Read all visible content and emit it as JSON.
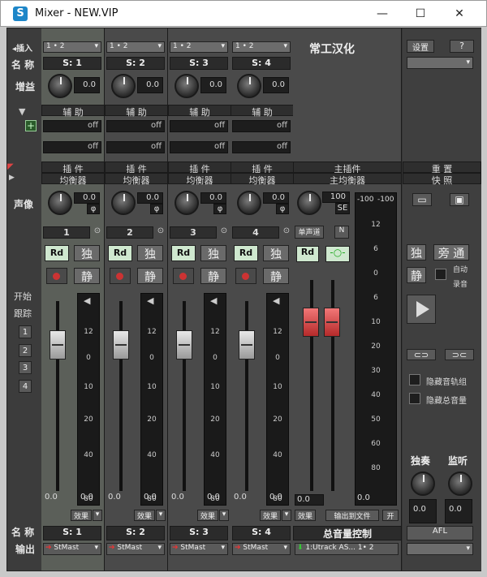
{
  "window": {
    "title": "Mixer - NEW.VIP",
    "icon": "S",
    "min": "—",
    "max": "☐",
    "close": "✕"
  },
  "rows": {
    "insert": "◂插入",
    "name": "名 称",
    "gain": "增益",
    "aux": "辅 助",
    "plugin": "插 件",
    "eq": "均衡器",
    "pan": "声像",
    "start": "开始",
    "follow": "跟踪",
    "bottom_name": "名 称",
    "bottom_out": "输出"
  },
  "follow_nums": [
    "1",
    "2",
    "3",
    "4"
  ],
  "channels": [
    {
      "num": "1",
      "input": "1 • 2",
      "name": "S: 1",
      "gain": "0.0",
      "pan": "0.0",
      "fader": "0.0",
      "plugin": "插 件",
      "eq": "均衡器",
      "aux": "辅 助",
      "off1": "off",
      "off2": "off",
      "rd": "Rd",
      "solo": "独",
      "mute": "静",
      "effect": "效果",
      "output": "StMast",
      "bname": "S: 1"
    },
    {
      "num": "2",
      "input": "1 • 2",
      "name": "S: 2",
      "gain": "0.0",
      "pan": "0.0",
      "fader": "0.0",
      "plugin": "插 件",
      "eq": "均衡器",
      "aux": "辅 助",
      "off1": "off",
      "off2": "off",
      "rd": "Rd",
      "solo": "独",
      "mute": "静",
      "effect": "效果",
      "output": "StMast",
      "bname": "S: 2"
    },
    {
      "num": "3",
      "input": "1 • 2",
      "name": "S: 3",
      "gain": "0.0",
      "pan": "0.0",
      "fader": "0.0",
      "plugin": "插 件",
      "eq": "均衡器",
      "aux": "辅 助",
      "off1": "off",
      "off2": "off",
      "rd": "Rd",
      "solo": "独",
      "mute": "静",
      "effect": "效果",
      "output": "StMast",
      "bname": "S: 3"
    },
    {
      "num": "4",
      "input": "1 • 2",
      "name": "S: 4",
      "gain": "0.0",
      "pan": "0.0",
      "fader": "0.0",
      "plugin": "插 件",
      "eq": "均衡器",
      "aux": "辅 助",
      "off1": "off",
      "off2": "off",
      "rd": "Rd",
      "solo": "独",
      "mute": "静",
      "effect": "效果",
      "output": "StMast",
      "bname": "S: 4"
    }
  ],
  "meter_ticks": [
    "12",
    "0",
    "10",
    "20",
    "40",
    "80"
  ],
  "master": {
    "title": "常工汉化",
    "plugin": "主插件",
    "eq": "主均衡器",
    "pan": "100",
    "se": "SE",
    "mono": "单声道",
    "n": "N",
    "rd": "Rd",
    "fader": "0.0",
    "peakL": "-100",
    "peakR": "-100",
    "effect": "效果",
    "output_to_file": "输出到文件",
    "on": "开",
    "ctrl": "总音量控制",
    "out": "1:Utrack AS... 1• 2",
    "ticks": [
      "12",
      "6",
      "0",
      "6",
      "10",
      "20",
      "30",
      "40",
      "50",
      "60",
      "80"
    ],
    "meter_val": "0.0"
  },
  "right": {
    "settings": "设置",
    "help": "?",
    "reset": "重 置",
    "snapshot": "快 照",
    "solo": "独",
    "bypass": "旁 通",
    "mute": "静",
    "auto": "自动",
    "record": "录音",
    "hide_tracks": "隐藏音轨组",
    "hide_master": "隐藏总音量",
    "solo_label": "独奏",
    "monitor_label": "监听",
    "solo_val": "0.0",
    "monitor_val": "0.0",
    "afl": "AFL"
  }
}
